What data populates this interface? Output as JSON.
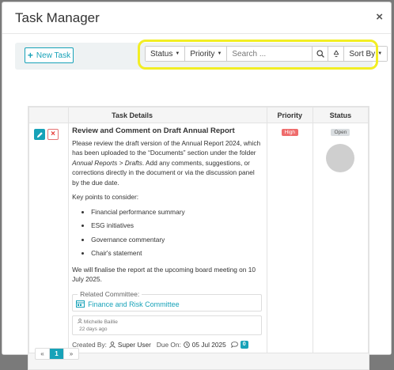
{
  "modal": {
    "title": "Task Manager",
    "close_label": "×"
  },
  "toolbar": {
    "new_task_label": "New Task",
    "status_label": "Status",
    "priority_label": "Priority",
    "search_placeholder": "Search ...",
    "sort_label": "Sort By"
  },
  "table": {
    "headers": {
      "details": "Task Details",
      "priority": "Priority",
      "status": "Status"
    },
    "rows": [
      {
        "title": "Review and Comment on Draft Annual Report",
        "description_1": "Please review the draft version of the Annual Report 2024, which has been uploaded to the “Documents” section under the folder ",
        "folder_path": "Annual Reports > Drafts",
        "description_2": ". Add any comments, suggestions, or corrections directly in the document or via the discussion panel by the due date.",
        "key_points_intro": "Key points to consider:",
        "key_points": [
          "Financial performance summary",
          "ESG initiatives",
          "Governance commentary",
          "Chair's statement"
        ],
        "finalise": "We will finalise the report at the upcoming board meeting on 10 July 2025.",
        "related_legend": "Related Committee:",
        "committee": "Finance and Risk Committee",
        "comment_author": "Michelle Baillie",
        "comment_time": "22 days ago",
        "created_by_label": "Created By:",
        "created_by": "Super User",
        "due_on_label": "Due On:",
        "due_on": "05 Jul 2025",
        "comment_count": "0",
        "priority": "High",
        "status": "Open"
      }
    ]
  },
  "pagination": {
    "prev": "«",
    "current": "1",
    "next": "»"
  },
  "colors": {
    "accent": "#17a2b8",
    "danger": "#ef6c6c",
    "highlight": "#f2ee24"
  }
}
